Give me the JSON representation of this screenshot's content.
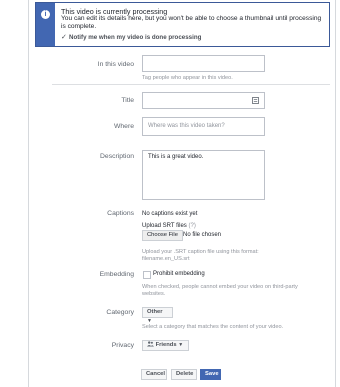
{
  "banner": {
    "title": "This video is currently processing",
    "text": "You can edit its details here, but you won't be able to choose a thumbnail until processing is complete.",
    "check_glyph": "✓",
    "notify_label": "Notify me when my video is done processing",
    "icon": "info-icon"
  },
  "tags": {
    "label": "In this video",
    "help": "Tag people who appear in this video."
  },
  "title_field": {
    "label": "Title",
    "icon": "form-icon"
  },
  "where": {
    "label": "Where",
    "placeholder": "Where was this video taken?"
  },
  "description": {
    "label": "Description",
    "value": "This is a great video."
  },
  "captions": {
    "label": "Captions",
    "status": "No captions exist yet",
    "upload_label": "Upload SRT files",
    "help_mark": "(?)",
    "choose_button": "Choose File",
    "no_file": "No file chosen",
    "help_line1": "Upload your .SRT caption file using this format:",
    "help_line2": "filename.en_US.srt"
  },
  "embedding": {
    "label": "Embedding",
    "checkbox_label": "Prohibit embedding",
    "help": "When checked, people cannot embed your video on third-party websites."
  },
  "category": {
    "label": "Category",
    "selected": "Other",
    "help": "Select a category that matches the content of your video."
  },
  "privacy": {
    "label": "Privacy",
    "selected": "Friends",
    "icon": "friends-icon"
  },
  "actions": {
    "cancel": "Cancel",
    "delete": "Delete",
    "save": "Save"
  }
}
